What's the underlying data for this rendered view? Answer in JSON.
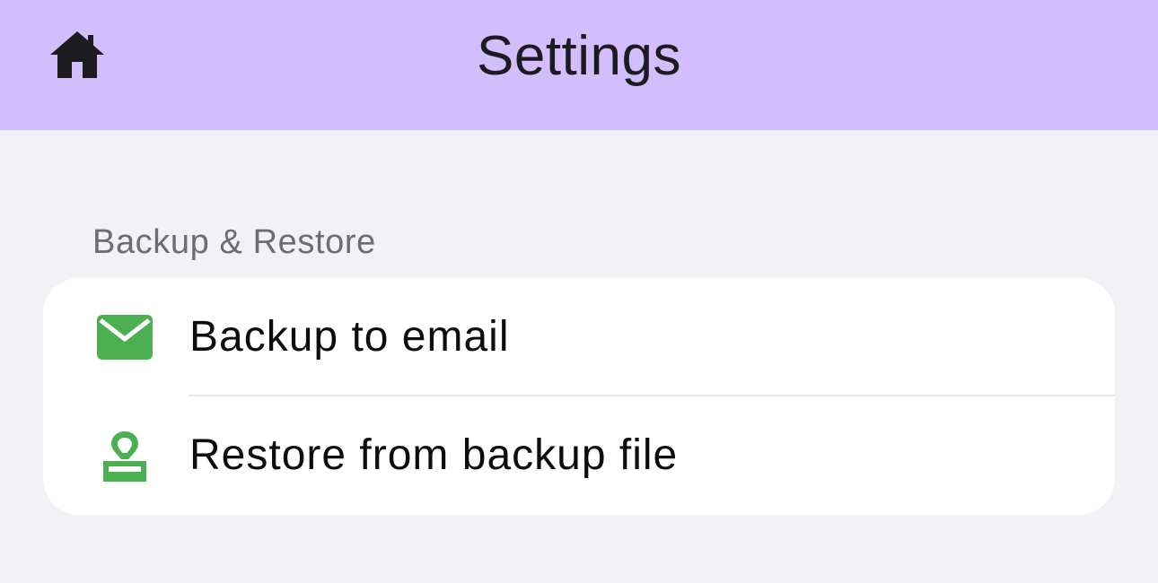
{
  "nav": {
    "title": "Settings",
    "home_icon": "home-icon",
    "background_color": "#d2bdfd"
  },
  "section": {
    "header": "Backup & Restore",
    "items": [
      {
        "label": "Backup to email",
        "icon": "mail-icon",
        "icon_color": "#4caf50"
      },
      {
        "label": "Restore from backup file",
        "icon": "stamp-icon",
        "icon_color": "#4caf50"
      }
    ]
  }
}
